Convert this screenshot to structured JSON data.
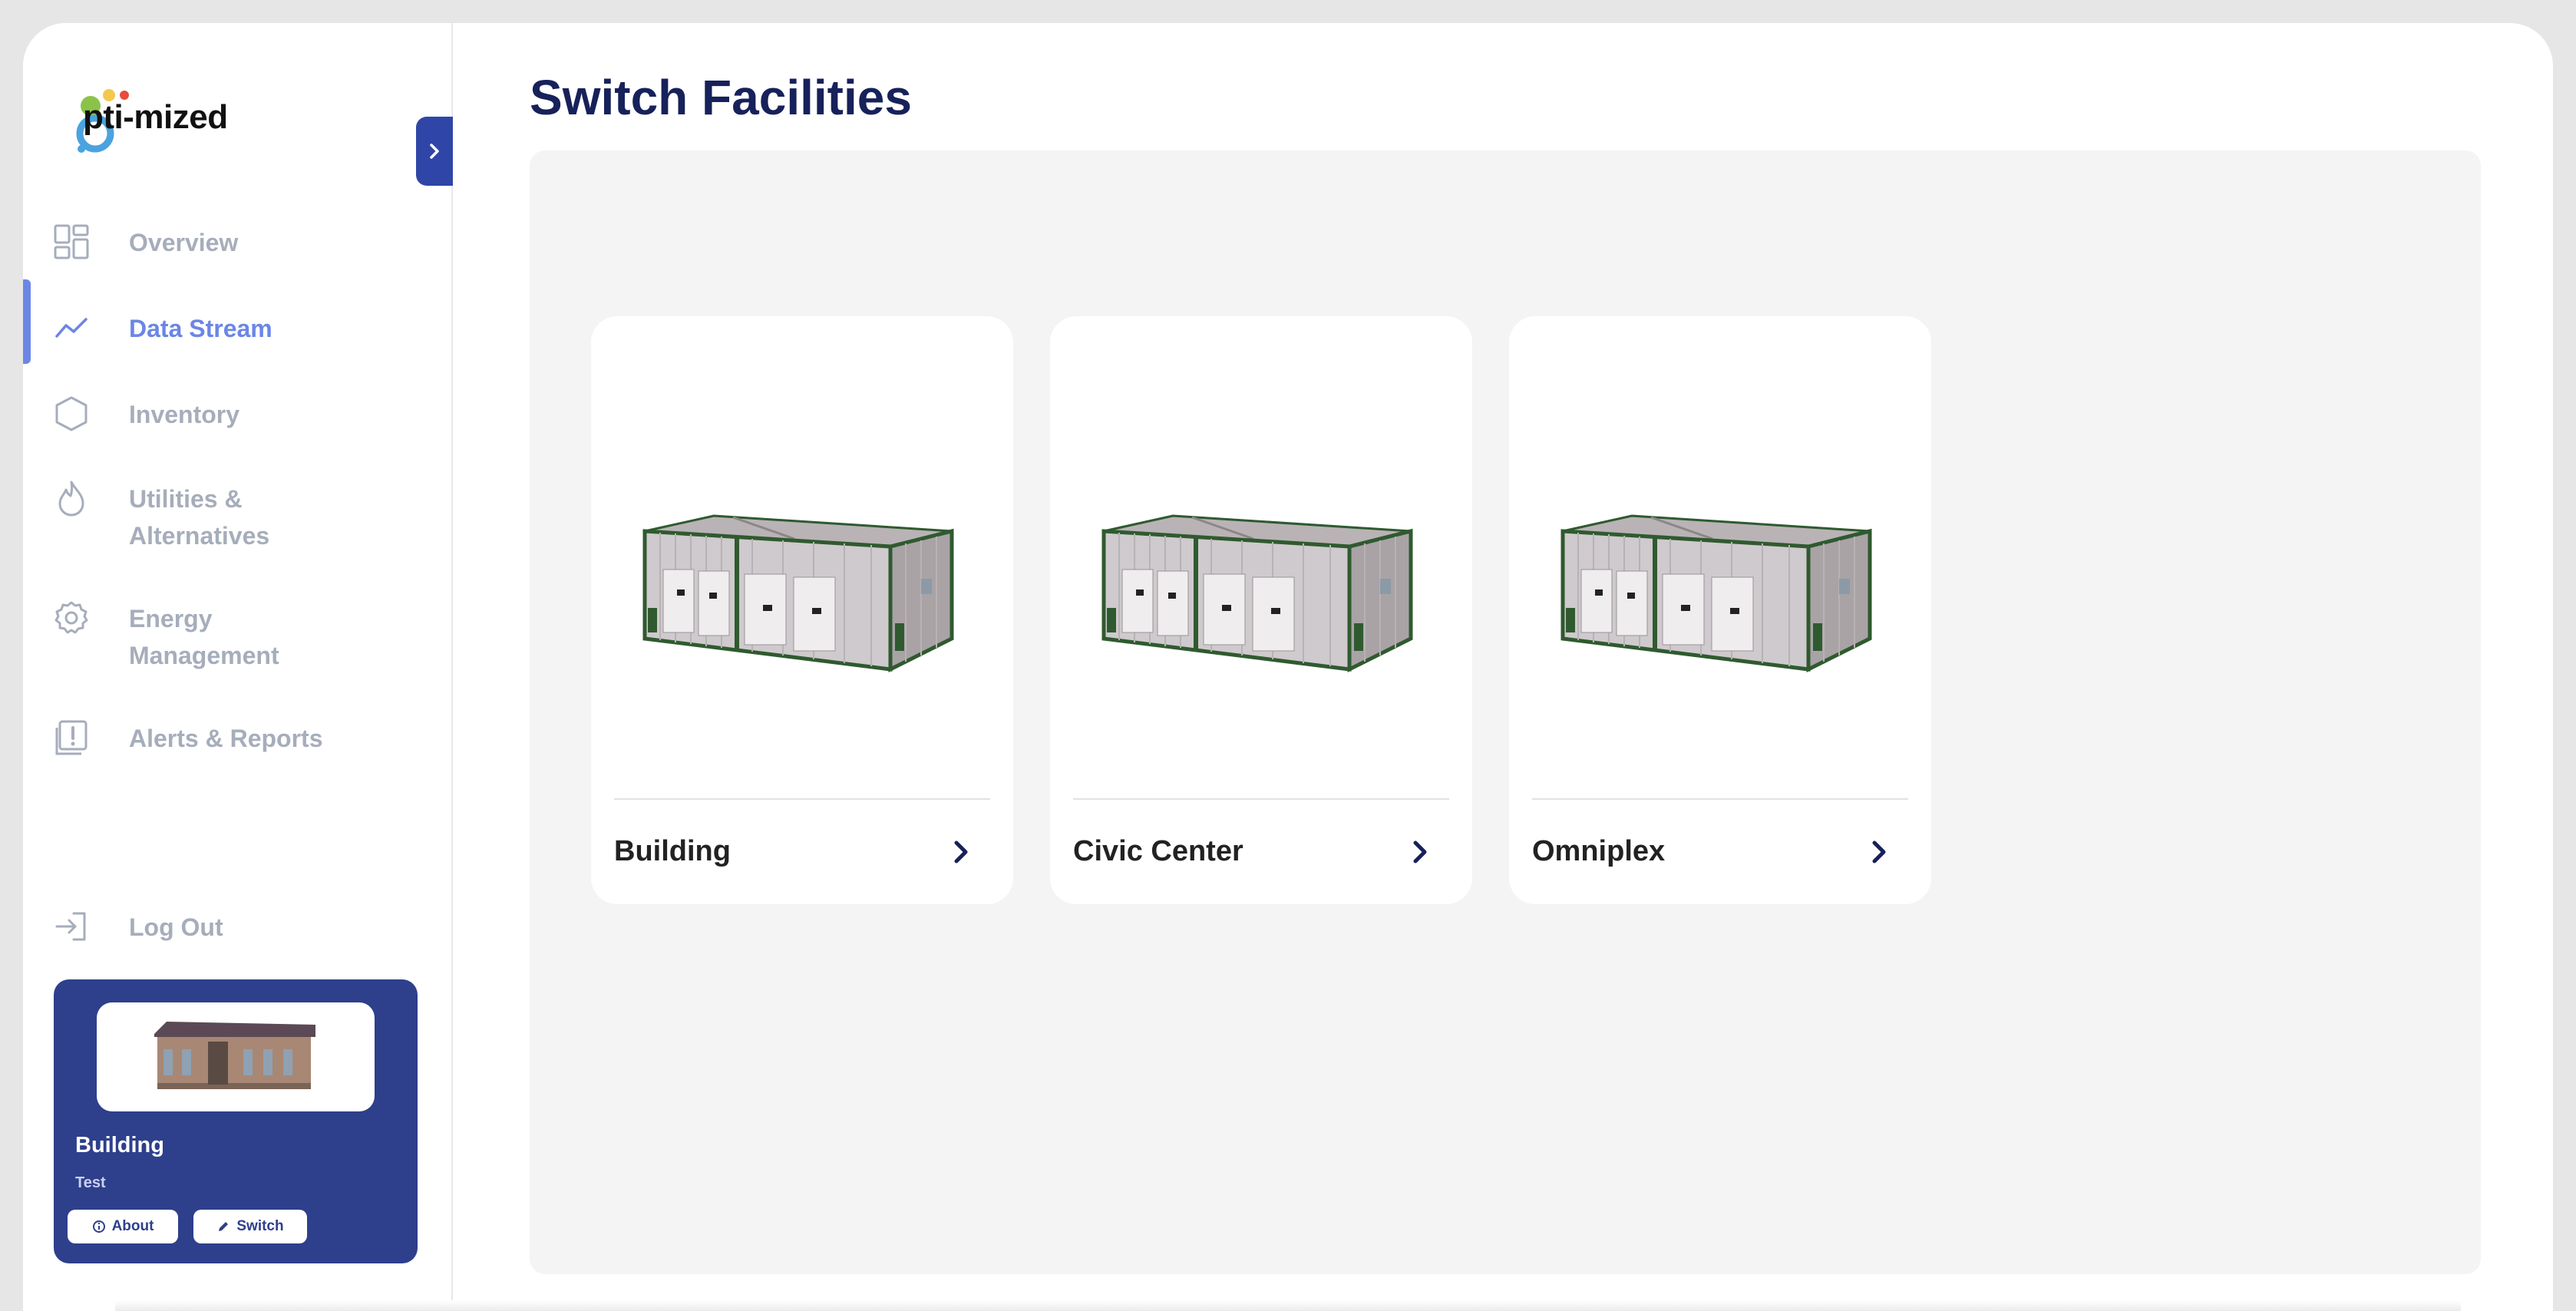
{
  "app": {
    "logo_text": "pti-mized",
    "logo_letter": "O"
  },
  "sidebar": {
    "items": [
      {
        "label": "Overview",
        "icon": "grid-icon",
        "active": false
      },
      {
        "label": "Data Stream",
        "icon": "trend-line-icon",
        "active": true
      },
      {
        "label": "Inventory",
        "icon": "hexagon-icon",
        "active": false
      },
      {
        "label": "Utilities & Alternatives",
        "line1": "Utilities &",
        "line2": "Alternatives",
        "icon": "flame-icon",
        "active": false
      },
      {
        "label": "Energy Management",
        "line1": "Energy",
        "line2": "Management",
        "icon": "gear-icon",
        "active": false
      },
      {
        "label": "Alerts & Reports",
        "icon": "alert-report-icon",
        "active": false
      }
    ],
    "logout_label": "Log Out",
    "current_facility": {
      "name": "Building",
      "subtitle": "Test",
      "about_label": "About",
      "switch_label": "Switch"
    }
  },
  "main": {
    "title": "Switch Facilities",
    "facilities": [
      {
        "name": "Building"
      },
      {
        "name": "Civic Center"
      },
      {
        "name": "Omniplex"
      }
    ]
  },
  "colors": {
    "accent": "#6b86e6",
    "navy": "#17215a",
    "card_blue": "#2e3f8c",
    "muted": "#a6adbb"
  }
}
